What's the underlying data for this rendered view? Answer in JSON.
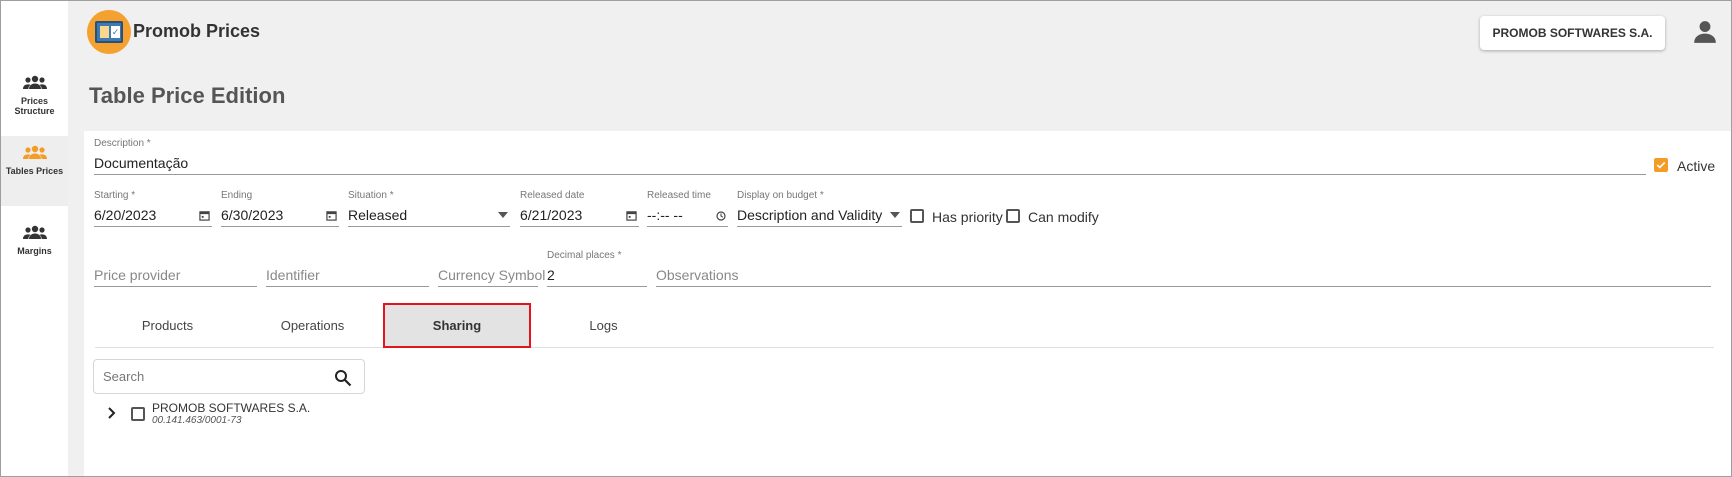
{
  "app": {
    "title": "Promob Prices",
    "company": "PROMOB SOFTWARES S.A.",
    "accent_color": "#f39c26",
    "highlight_color": "#e3141c"
  },
  "sidebar": {
    "items": [
      {
        "label": "Prices Structure",
        "icon": "users-icon",
        "active": false
      },
      {
        "label": "Tables Prices",
        "icon": "users-icon",
        "active": true
      },
      {
        "label": "Margins",
        "icon": "users-icon",
        "active": false
      }
    ]
  },
  "page": {
    "title": "Table Price Edition"
  },
  "form": {
    "description": {
      "label": "Description *",
      "value": "Documentação"
    },
    "active": {
      "label": "Active",
      "checked": true
    },
    "starting": {
      "label": "Starting *",
      "value": "6/20/2023"
    },
    "ending": {
      "label": "Ending",
      "value": "6/30/2023"
    },
    "situation": {
      "label": "Situation *",
      "value": "Released"
    },
    "released_date": {
      "label": "Released date",
      "value": "6/21/2023"
    },
    "released_time": {
      "label": "Released time",
      "value": "--:-- --"
    },
    "display_on_budget": {
      "label": "Display on budget *",
      "value": "Description and Validity"
    },
    "has_priority": {
      "label": "Has priority",
      "checked": false
    },
    "can_modify": {
      "label": "Can modify",
      "checked": false
    },
    "price_provider": {
      "placeholder": "Price provider"
    },
    "identifier": {
      "placeholder": "Identifier"
    },
    "currency_symbol": {
      "placeholder": "Currency Symbol"
    },
    "decimal_places": {
      "label": "Decimal places *",
      "value": "2"
    },
    "observations": {
      "placeholder": "Observations"
    }
  },
  "tabs": [
    {
      "label": "Products",
      "active": false
    },
    {
      "label": "Operations",
      "active": false
    },
    {
      "label": "Sharing",
      "active": true
    },
    {
      "label": "Logs",
      "active": false
    }
  ],
  "sharing": {
    "search_placeholder": "Search",
    "companies": [
      {
        "name": "PROMOB SOFTWARES S.A.",
        "document": "00.141.463/0001-73",
        "checked": false
      }
    ]
  }
}
